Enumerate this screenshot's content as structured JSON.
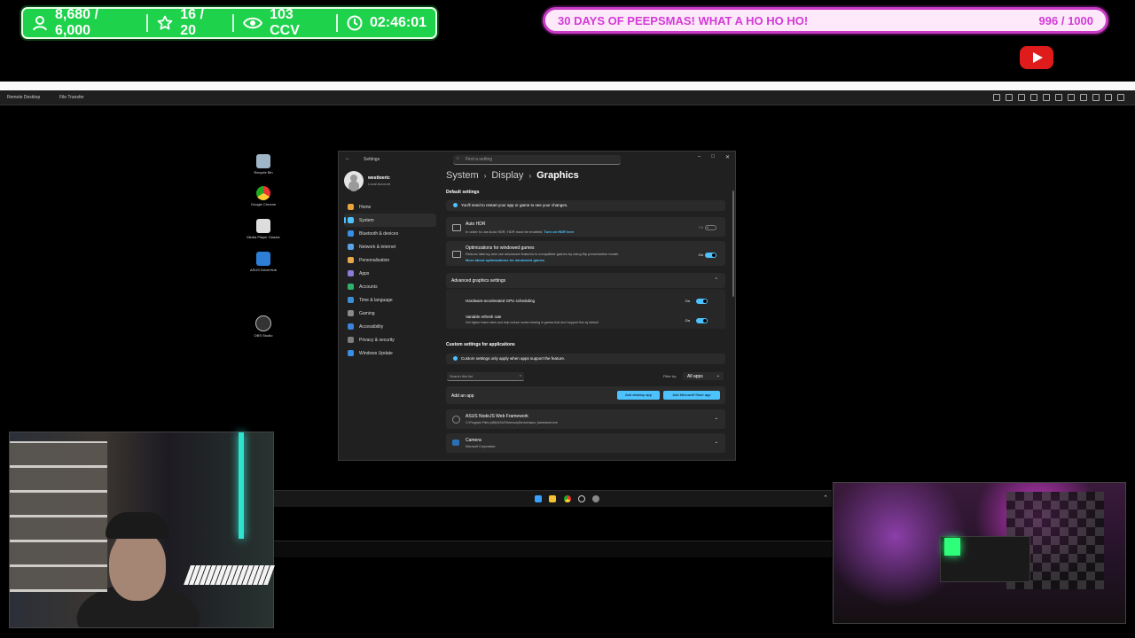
{
  "overlay": {
    "stats": {
      "followers": "8,680 / 6,000",
      "subs": "16 / 20",
      "viewers": "103 CCV",
      "uptime": "02:46:01"
    },
    "goal": {
      "text": "30 DAYS OF PEEPSMAS! WHAT A HO HO HO!",
      "progress": "996 / 1000",
      "progress_fraction": 0.996
    },
    "colors": {
      "stats_bg": "#1fd24c",
      "goal_border": "#c93bc6",
      "goal_text": "#d43ad8"
    }
  },
  "remote_desktop": {
    "toolbar": {
      "remote_desktop": "Remote Desktop",
      "file_transfer": "File Transfer"
    }
  },
  "desktop_icons": [
    {
      "label": "Recycle Bin",
      "icon": "recycle-bin-icon"
    },
    {
      "label": "Google Chrome",
      "icon": "chrome-icon"
    },
    {
      "label": "Media Player Classic",
      "icon": "media-player-icon"
    },
    {
      "label": "ASUS DriverHub",
      "icon": "asus-driverhub-icon"
    },
    {
      "label": "OBS Studio",
      "icon": "obs-icon"
    }
  ],
  "settings": {
    "window_title": "Settings",
    "search_placeholder": "Find a setting",
    "user": {
      "name": "westtoeric",
      "type": "Local Account"
    },
    "nav": [
      {
        "label": "Home",
        "color": "#e8a33b"
      },
      {
        "label": "System",
        "color": "#4cc2ff",
        "active": true
      },
      {
        "label": "Bluetooth & devices",
        "color": "#3a8ee6"
      },
      {
        "label": "Network & internet",
        "color": "#5aa1e6"
      },
      {
        "label": "Personalization",
        "color": "#e6a94b"
      },
      {
        "label": "Apps",
        "color": "#8c7bd8"
      },
      {
        "label": "Accounts",
        "color": "#2fb36b"
      },
      {
        "label": "Time & language",
        "color": "#3b8fd6"
      },
      {
        "label": "Gaming",
        "color": "#8a8a8a"
      },
      {
        "label": "Accessibility",
        "color": "#3a83d8"
      },
      {
        "label": "Privacy & security",
        "color": "#7d7d7d"
      },
      {
        "label": "Windows Update",
        "color": "#3a8ee6"
      }
    ],
    "breadcrumb": {
      "system": "System",
      "display": "Display",
      "graphics": "Graphics"
    },
    "default_settings": {
      "title": "Default settings",
      "restart_notice": "You'll need to restart your app or game to see your changes.",
      "auto_hdr": {
        "title": "Auto HDR",
        "desc": "In order to use Auto HDR, HDR must be enabled.",
        "link": "Turn on HDR here",
        "state": "Off"
      },
      "windowed_games": {
        "title": "Optimizations for windowed games",
        "desc": "Reduce latency and use advanced features in compatible games by using flip presentation model.",
        "link": "More about optimizations for windowed games",
        "state": "On"
      }
    },
    "advanced": {
      "title": "Advanced graphics settings",
      "gpu_scheduling": {
        "title": "Hardware-accelerated GPU scheduling",
        "state": "On"
      },
      "vrr": {
        "title": "Variable refresh rate",
        "desc": "Get higher frame rates and help reduce screen tearing in games that don't support this by default",
        "state": "On"
      }
    },
    "custom": {
      "title": "Custom settings for applications",
      "notice": "Custom settings only apply when apps support the feature.",
      "search_placeholder": "Search this list",
      "filter_label": "Filter by:",
      "filter_value": "All apps",
      "add_app_label": "Add an app",
      "add_desktop_app": "Add desktop app",
      "add_store_app": "Add Microsoft Store app",
      "apps": [
        {
          "name": "ASUS NodeJS Web Framework",
          "path": "C:\\Program Files (x86)\\ASUS\\ArmouryDevice\\asus_framework.exe"
        },
        {
          "name": "Camera",
          "path": "Microsoft Corporation"
        }
      ]
    }
  }
}
